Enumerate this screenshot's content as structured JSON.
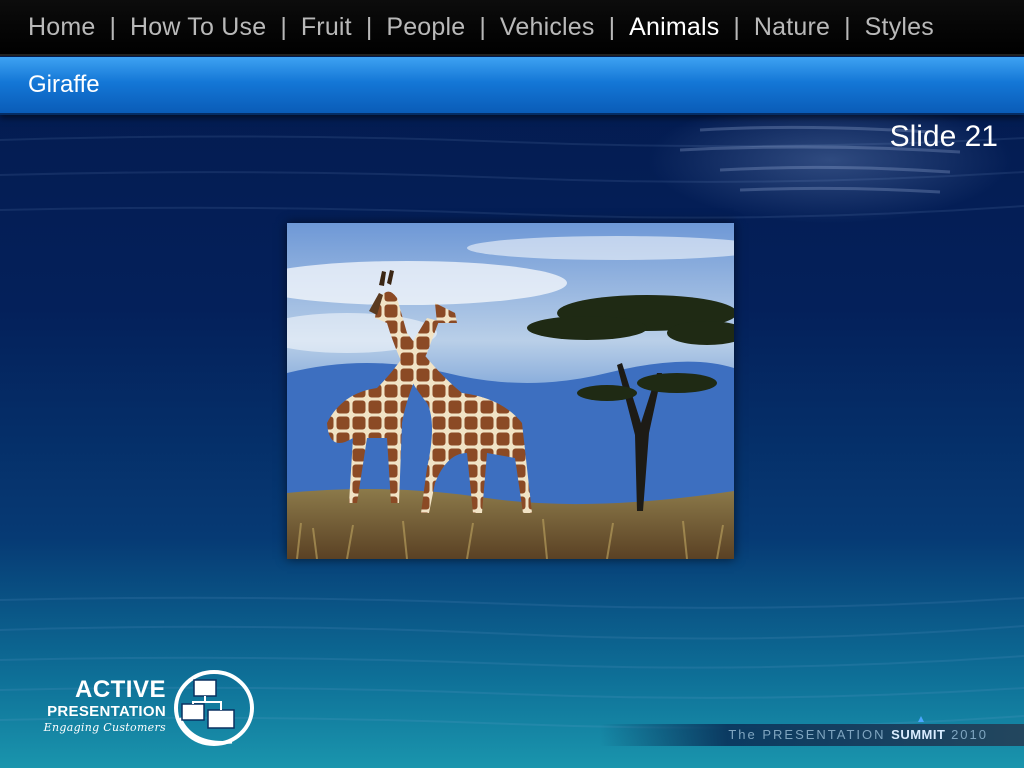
{
  "nav": {
    "items": [
      {
        "label": "Home",
        "active": false
      },
      {
        "label": "How To Use",
        "active": false
      },
      {
        "label": "Fruit",
        "active": false
      },
      {
        "label": "People",
        "active": false
      },
      {
        "label": "Vehicles",
        "active": false
      },
      {
        "label": "Animals",
        "active": true
      },
      {
        "label": "Nature",
        "active": false
      },
      {
        "label": "Styles",
        "active": false
      }
    ],
    "separator": "|"
  },
  "slide": {
    "title": "Giraffe",
    "number_label": "Slide 21"
  },
  "photo": {
    "subject": "two giraffes and acacia tree"
  },
  "logo": {
    "line1": "ACTIVE",
    "line2": "PRESENTATION",
    "line3": "Engaging Customers"
  },
  "footer": {
    "text_prefix": "The PRESENTATION",
    "text_highlight": "SUMMIT",
    "text_suffix": "2010"
  },
  "colors": {
    "nav_bg": "#000000",
    "nav_text": "#b9b9b9",
    "nav_active": "#ffffff",
    "title_band": "#1477d6",
    "background": "#04205a"
  }
}
